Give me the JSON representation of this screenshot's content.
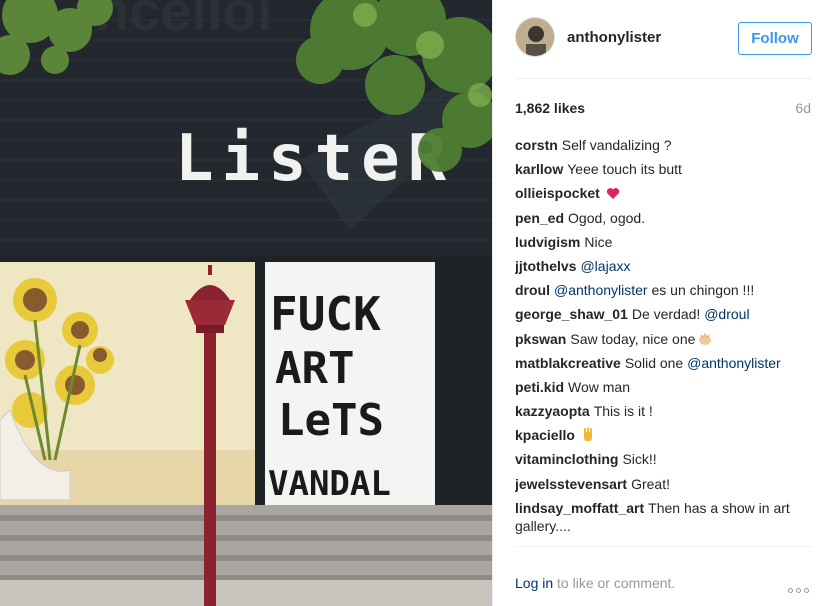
{
  "post": {
    "username": "anthonylister",
    "follow_label": "Follow",
    "likes": "1,862 likes",
    "age": "6d",
    "login_link": "Log in",
    "login_rest": " to like or comment."
  },
  "photo": {
    "wall_text": "ListeR",
    "graffiti_line1": "FUCK",
    "graffiti_line2": "ART",
    "graffiti_line3": "LeTS",
    "graffiti_line4": "VANDAL"
  },
  "comments": [
    {
      "user": "corstn",
      "text": "Self vandalizing ?"
    },
    {
      "user": "karllow",
      "text": "Yeee touch its butt"
    },
    {
      "user": "ollieispocket",
      "text": "",
      "emoji": "heart"
    },
    {
      "user": "pen_ed",
      "text": "Ogod, ogod."
    },
    {
      "user": "ludvigism",
      "text": "Nice"
    },
    {
      "user": "jjtothelvs",
      "text": "",
      "mention": "@lajaxx"
    },
    {
      "user": "droul",
      "text": "",
      "mention": "@anthonylister",
      "text_after": " es un chingon !!!"
    },
    {
      "user": "george_shaw_01",
      "text": "De verdad! ",
      "mention": "@droul"
    },
    {
      "user": "pkswan",
      "text": "Saw today, nice one",
      "emoji": "clap"
    },
    {
      "user": "matblakcreative",
      "text": "Solid one ",
      "mention": "@anthonylister"
    },
    {
      "user": "peti.kid",
      "text": "Wow man"
    },
    {
      "user": "kazzyaopta",
      "text": "This is it !"
    },
    {
      "user": "kpaciello",
      "text": "",
      "emoji": "hand"
    },
    {
      "user": "vitaminclothing",
      "text": "Sick!!"
    },
    {
      "user": "jewelsstevensart",
      "text": "Great!"
    },
    {
      "user": "lindsay_moffatt_art",
      "text": "Then has a show in art gallery...."
    }
  ]
}
